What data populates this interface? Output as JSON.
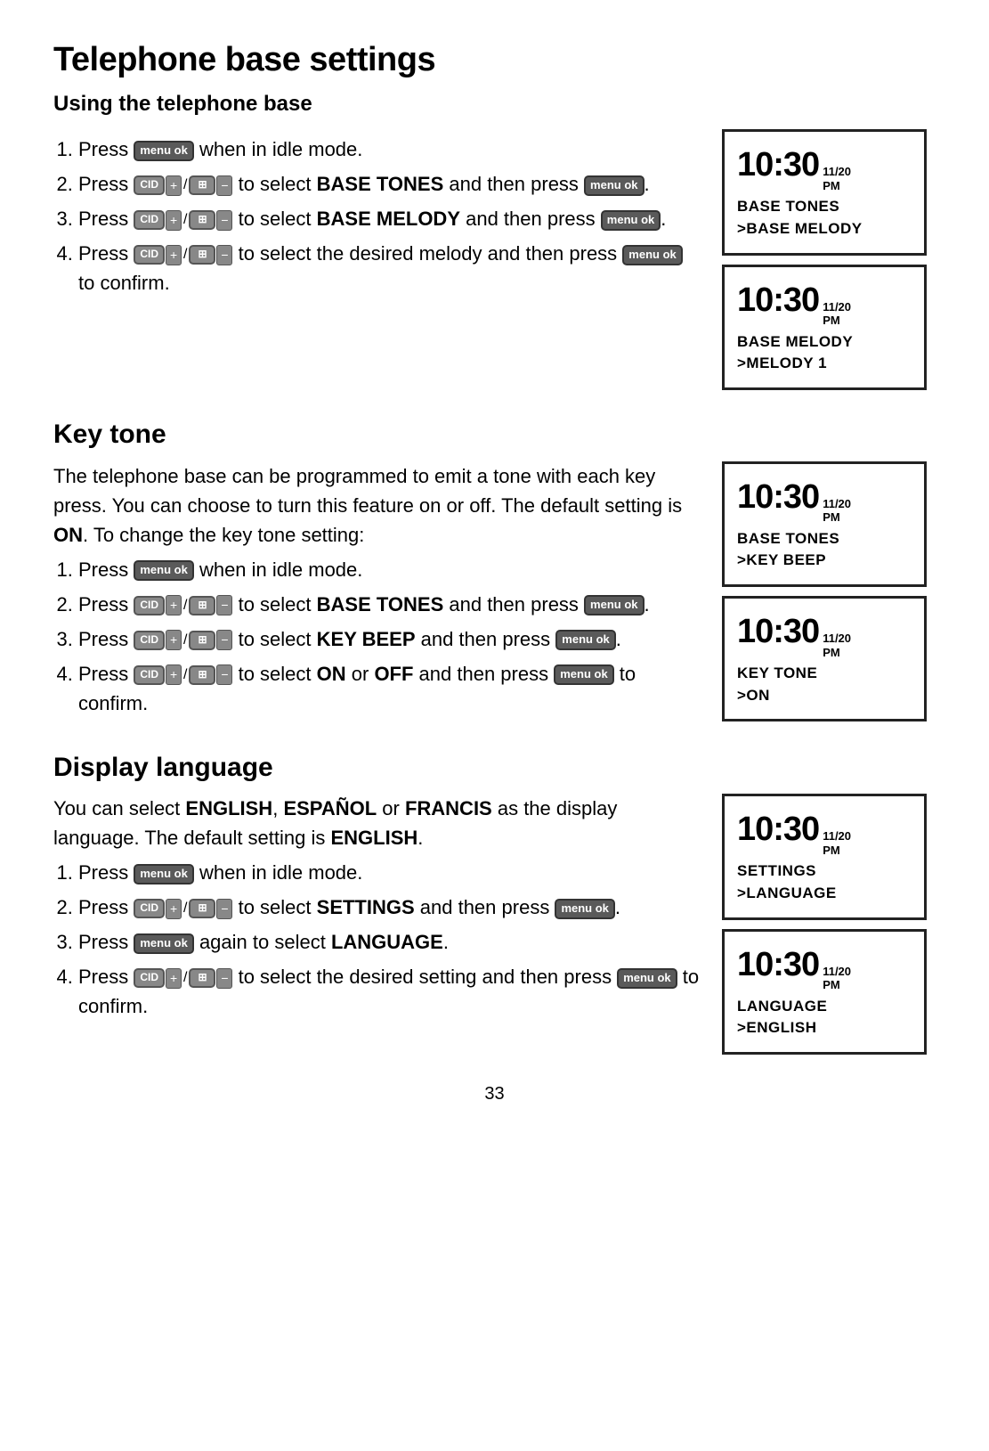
{
  "page": {
    "title": "Telephone base settings",
    "subtitle": "Using the telephone base",
    "page_number": "33"
  },
  "sections": {
    "telephone_base": {
      "steps": [
        {
          "id": 1,
          "text_before": "Press",
          "button": "menu_ok",
          "text_after": "when in idle mode."
        },
        {
          "id": 2,
          "text_before": "Press",
          "button": "cid_plus_book_minus",
          "text_middle": "to select",
          "bold": "BASE TONES",
          "text_after": "and then press",
          "button2": "menu_ok",
          "text_end": "."
        },
        {
          "id": 2,
          "text_before": "Press",
          "button": "cid_plus_book_minus",
          "text_middle": "to select",
          "bold": "BASE MELODY",
          "text_after": "and then press",
          "button2": "menu_ok",
          "text_end": "."
        },
        {
          "id": 3,
          "text_before": "Press",
          "button": "cid_plus_book_minus",
          "text_middle": "to select the desired melody and then press",
          "button2": "menu_ok",
          "text_after": "to confirm."
        }
      ],
      "screens": [
        {
          "time": "10:30",
          "date": "11/20",
          "ampm": "PM",
          "line1": "BASE TONES",
          "line2": ">BASE MELODY"
        },
        {
          "time": "10:30",
          "date": "11/20",
          "ampm": "PM",
          "line1": "BASE MELODY",
          "line2": ">MELODY 1"
        }
      ]
    },
    "key_tone": {
      "title": "Key tone",
      "description": "The telephone base can be programmed to emit a tone with each key press. You can choose to turn this feature on or off. The default setting is",
      "bold_word": "ON",
      "description2": ". To change the key tone setting:",
      "steps": [
        {
          "id": 1,
          "text": "Press",
          "button": "menu_ok",
          "text2": "when in idle mode."
        },
        {
          "id": 2,
          "text": "Press",
          "button": "cid_plus_book_minus",
          "text2": "to select",
          "bold": "BASE TONES",
          "text3": "and then press",
          "button2": "menu_ok",
          "text4": "."
        },
        {
          "id": 2,
          "text": "Press",
          "button": "cid_plus_book_minus",
          "text2": "to select",
          "bold": "KEY BEEP",
          "text3": "and then press",
          "button2": "menu_ok",
          "text4": "."
        },
        {
          "id": 4,
          "text": "Press",
          "button": "cid_plus_book_minus",
          "text2": "to select",
          "bold1": "ON",
          "text3": "or",
          "bold2": "OFF",
          "text4": "and then press",
          "button2": "menu_ok",
          "text5": "to confirm."
        }
      ],
      "screens": [
        {
          "time": "10:30",
          "date": "11/20",
          "ampm": "PM",
          "line1": "BASE TONES",
          "line2": ">KEY BEEP"
        },
        {
          "time": "10:30",
          "date": "11/20",
          "ampm": "PM",
          "line1": "KEY TONE",
          "line2": ">ON"
        }
      ]
    },
    "display_language": {
      "title": "Display language",
      "description": "You can select",
      "bold1": "ENGLISH",
      "sep1": ", ",
      "bold2": "ESPAÑOL",
      "sep2": " or ",
      "bold3": "FRANCIS",
      "rest": "as the display language. The default setting is",
      "bold4": "ENGLISH",
      "period": ".",
      "steps": [
        {
          "id": 1,
          "text": "Press",
          "button": "menu_ok",
          "text2": "when in idle mode."
        },
        {
          "id": 2,
          "text": "Press",
          "button": "cid_plus_book_minus",
          "text2": "to select",
          "bold": "SETTINGS",
          "text3": "and then press",
          "button2": "menu_ok",
          "text4": "."
        },
        {
          "id": 3,
          "text": "Press",
          "button": "menu_ok",
          "text2": "again to select",
          "bold": "LANGUAGE",
          "text3": "."
        },
        {
          "id": 4,
          "text": "Press",
          "button": "cid_plus_book_minus",
          "text2": "to select the desired setting and then press",
          "button2": "menu_ok",
          "text3": "to confirm."
        }
      ],
      "screens": [
        {
          "time": "10:30",
          "date": "11/20",
          "ampm": "PM",
          "line1": "SETTINGS",
          "line2": ">LANGUAGE"
        },
        {
          "time": "10:30",
          "date": "11/20",
          "ampm": "PM",
          "line1": "LANGUAGE",
          "line2": ">ENGLISH"
        }
      ]
    }
  },
  "labels": {
    "menu_ok": "menu ok",
    "cid": "CID",
    "plus": "+",
    "minus": "−",
    "book": "⊞"
  }
}
